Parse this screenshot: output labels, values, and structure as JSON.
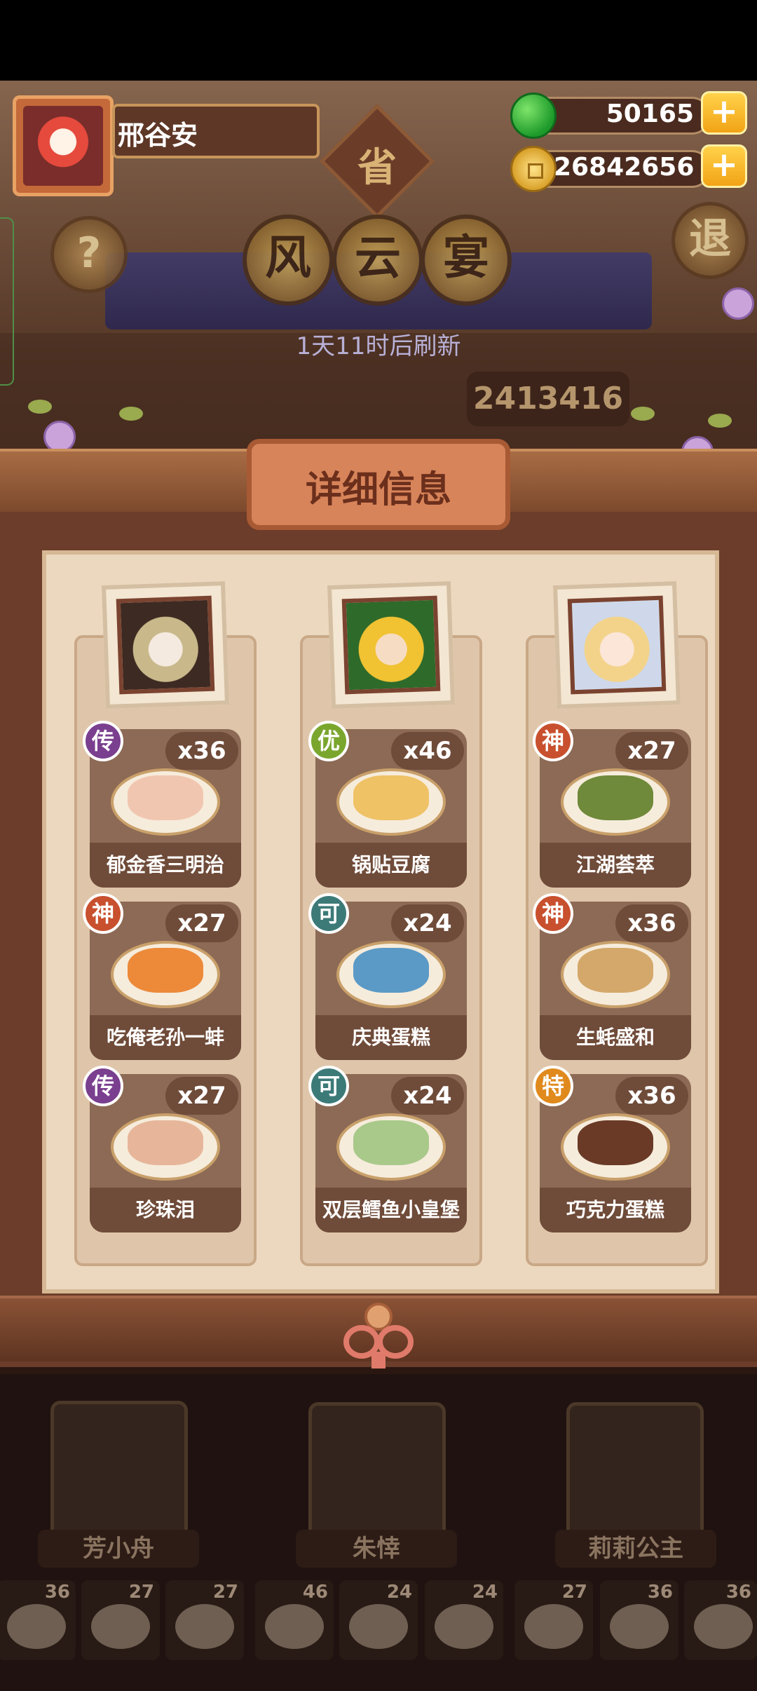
{
  "player": {
    "name": "邢谷安"
  },
  "resources": {
    "jade": "50165",
    "coins": "26842656",
    "plus_symbol": "+"
  },
  "top_buttons": {
    "help": "?",
    "exit": "退",
    "seal": "省"
  },
  "title_chars": [
    "风",
    "云",
    "宴"
  ],
  "refresh_text": "1天11时后刷新",
  "score": "2413416",
  "panel_title": "详细信息",
  "columns": [
    {
      "dishes": [
        {
          "grade": "传",
          "grade_color": "#7a3f8f",
          "count": "x36",
          "name": "郁金香三明治",
          "food_color": "#f1c6b0"
        },
        {
          "grade": "神",
          "grade_color": "#c8502e",
          "count": "x27",
          "name": "吃俺老孙一蚌",
          "food_color": "#ec8a3a"
        },
        {
          "grade": "传",
          "grade_color": "#7a3f8f",
          "count": "x27",
          "name": "珍珠泪",
          "food_color": "#e7b69a"
        }
      ]
    },
    {
      "dishes": [
        {
          "grade": "优",
          "grade_color": "#7aa62e",
          "count": "x46",
          "name": "锅贴豆腐",
          "food_color": "#efc266"
        },
        {
          "grade": "可",
          "grade_color": "#3c7a78",
          "count": "x24",
          "name": "庆典蛋糕",
          "food_color": "#5b9ac6"
        },
        {
          "grade": "可",
          "grade_color": "#3c7a78",
          "count": "x24",
          "name": "双层鳕鱼小皇堡",
          "food_color": "#a9c98a"
        }
      ]
    },
    {
      "dishes": [
        {
          "grade": "神",
          "grade_color": "#c8502e",
          "count": "x27",
          "name": "江湖荟萃",
          "food_color": "#6f8a3a"
        },
        {
          "grade": "神",
          "grade_color": "#c8502e",
          "count": "x36",
          "name": "生蚝盛和",
          "food_color": "#d4a86a"
        },
        {
          "grade": "特",
          "grade_color": "#e08a1e",
          "count": "x36",
          "name": "巧克力蛋糕",
          "food_color": "#6a3a26"
        }
      ]
    }
  ],
  "characters": [
    {
      "name": "芳小舟"
    },
    {
      "name": "朱悻"
    },
    {
      "name": "莉莉公主"
    }
  ],
  "dish_strip_counts": [
    "36",
    "27",
    "27",
    "46",
    "24",
    "24",
    "27",
    "36",
    "36"
  ]
}
